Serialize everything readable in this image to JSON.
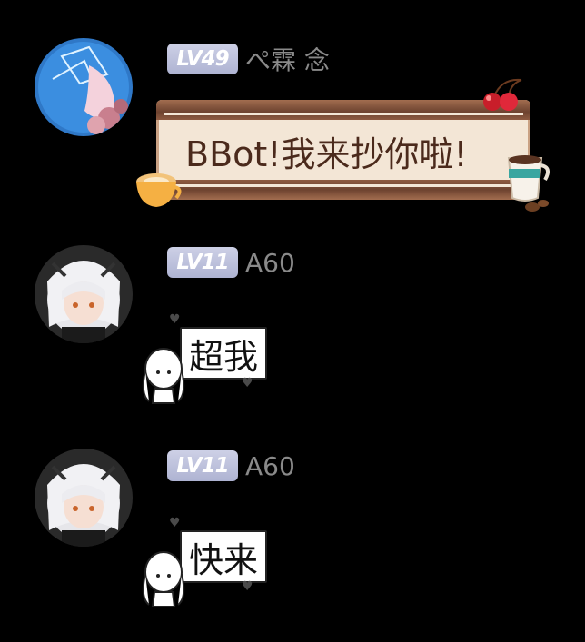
{
  "messages": [
    {
      "level": "LV49",
      "nickname": "ぺ霖 念",
      "text": "BBot!我来抄你啦!"
    },
    {
      "level": "LV11",
      "nickname": "A60",
      "text": "超我"
    },
    {
      "level": "LV11",
      "nickname": "A60",
      "text": "快来"
    }
  ],
  "colors": {
    "background": "#000000",
    "level_badge": "#b8bcd9",
    "nickname": "#8a8a8a",
    "fancy_bubble_paper": "#f3e6d6",
    "fancy_bubble_text": "#4b2a1c"
  }
}
